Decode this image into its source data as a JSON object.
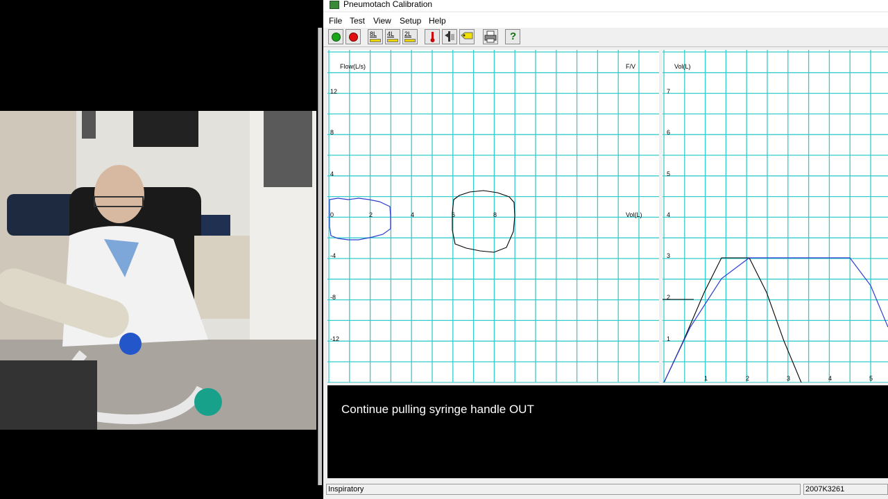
{
  "window": {
    "title": "Pneumotach Calibration"
  },
  "menu": [
    "File",
    "Test",
    "View",
    "Setup",
    "Help"
  ],
  "toolbar": {
    "start_icon": "green-circle-icon",
    "stop_icon": "red-circle-icon",
    "syringe_8l": "8L",
    "syringe_4l": "4L",
    "syringe_2l": "2L",
    "help": "?"
  },
  "colors": {
    "grid": "#33cccc",
    "trace_black": "#000000",
    "trace_blue": "#2a3bd0",
    "msg_bg": "#000000"
  },
  "fv_chart": {
    "ylabel": "Flow(L/s)",
    "xlabel": "Vol(L)",
    "corner": "F/V",
    "y_ticks": [
      "12",
      "8",
      "4",
      "0",
      "-4",
      "-8",
      "-12"
    ],
    "x_ticks": [
      "0",
      "2",
      "4",
      "6",
      "8"
    ]
  },
  "vt_chart": {
    "ylabel": "Vol(L)",
    "y_ticks": [
      "7",
      "6",
      "5",
      "4",
      "3",
      "2",
      "1"
    ],
    "x_ticks": [
      "1",
      "2",
      "3",
      "4",
      "5"
    ]
  },
  "message": "Continue pulling syringe handle OUT",
  "status": {
    "left": "Inspiratory",
    "right": "2007K3261"
  }
}
